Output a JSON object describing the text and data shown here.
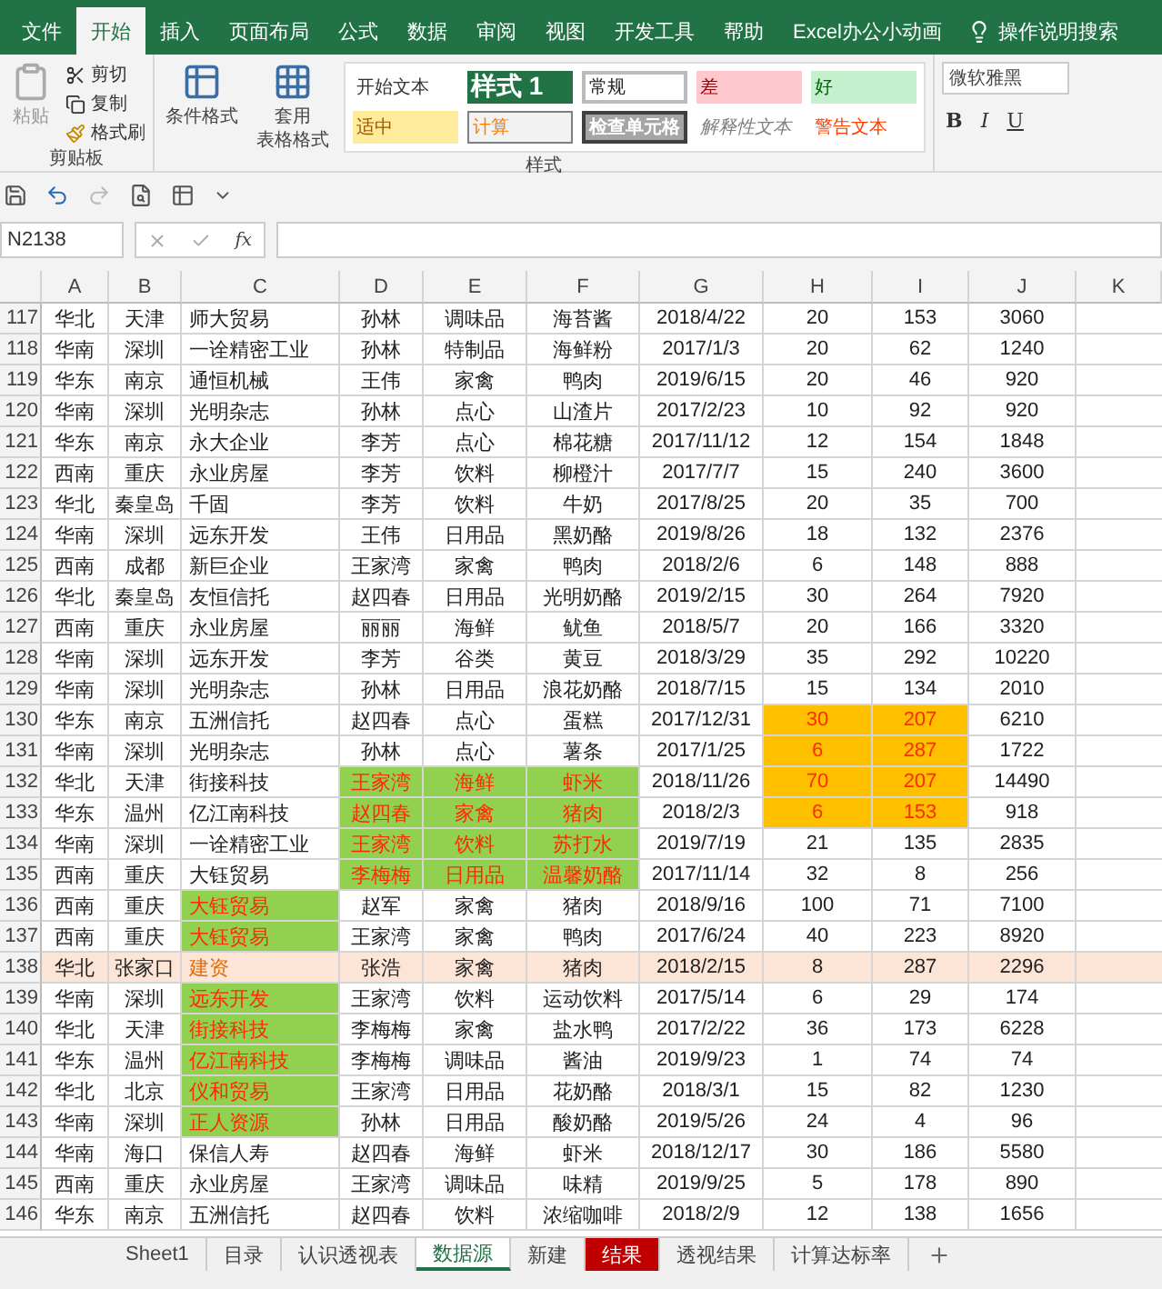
{
  "menu_tabs": [
    {
      "label": "文件",
      "selected": false
    },
    {
      "label": "开始",
      "selected": true
    },
    {
      "label": "插入",
      "selected": false
    },
    {
      "label": "页面布局",
      "selected": false
    },
    {
      "label": "公式",
      "selected": false
    },
    {
      "label": "数据",
      "selected": false
    },
    {
      "label": "审阅",
      "selected": false
    },
    {
      "label": "视图",
      "selected": false
    },
    {
      "label": "开发工具",
      "selected": false
    },
    {
      "label": "帮助",
      "selected": false
    },
    {
      "label": "Excel办公小动画",
      "selected": false
    }
  ],
  "tell_me": "操作说明搜索",
  "clipboard": {
    "paste": "粘贴",
    "cut": "剪切",
    "copy": "复制",
    "format_painter": "格式刷",
    "group_label": "剪贴板"
  },
  "styles": {
    "conditional_format": "条件格式",
    "table_format": [
      "套用",
      "表格格式"
    ],
    "group_label": "样式",
    "gallery": [
      {
        "text": "开始文本",
        "kind": "plain"
      },
      {
        "text": "样式 1",
        "kind": "title"
      },
      {
        "text": "常规",
        "kind": "normal"
      },
      {
        "text": "差",
        "kind": "bad"
      },
      {
        "text": "好",
        "kind": "good"
      },
      {
        "text": "适中",
        "kind": "neutral"
      },
      {
        "text": "计算",
        "kind": "calc"
      },
      {
        "text": "检查单元格",
        "kind": "check"
      },
      {
        "text": "解释性文本",
        "kind": "explain"
      },
      {
        "text": "警告文本",
        "kind": "warning"
      }
    ]
  },
  "font": {
    "name": "微软雅黑",
    "bold": "B",
    "italic": "I",
    "underline": "U"
  },
  "name_box": "N2138",
  "formula_label": "fx",
  "columns": [
    "A",
    "B",
    "C",
    "D",
    "E",
    "F",
    "G",
    "H",
    "I",
    "J",
    "K"
  ],
  "rows": [
    {
      "header": "117",
      "selected": false,
      "cells": [
        "华北",
        "天津",
        "师大贸易",
        "孙林",
        "调味品",
        "海苔酱",
        "2018/4/22",
        "20",
        "153",
        "3060"
      ]
    },
    {
      "header": "118",
      "selected": false,
      "cells": [
        "华南",
        "深圳",
        "一诠精密工业",
        "孙林",
        "特制品",
        "海鲜粉",
        "2017/1/3",
        "20",
        "62",
        "1240"
      ]
    },
    {
      "header": "119",
      "selected": false,
      "cells": [
        "华东",
        "南京",
        "通恒机械",
        "王伟",
        "家禽",
        "鸭肉",
        "2019/6/15",
        "20",
        "46",
        "920"
      ]
    },
    {
      "header": "120",
      "selected": false,
      "cells": [
        "华南",
        "深圳",
        "光明杂志",
        "孙林",
        "点心",
        "山渣片",
        "2017/2/23",
        "10",
        "92",
        "920"
      ]
    },
    {
      "header": "121",
      "selected": false,
      "cells": [
        "华东",
        "南京",
        "永大企业",
        "李芳",
        "点心",
        "棉花糖",
        "2017/11/12",
        "12",
        "154",
        "1848"
      ]
    },
    {
      "header": "122",
      "selected": false,
      "cells": [
        "西南",
        "重庆",
        "永业房屋",
        "李芳",
        "饮料",
        "柳橙汁",
        "2017/7/7",
        "15",
        "240",
        "3600"
      ]
    },
    {
      "header": "123",
      "selected": false,
      "cells": [
        "华北",
        "秦皇岛",
        "千固",
        "李芳",
        "饮料",
        "牛奶",
        "2017/8/25",
        "20",
        "35",
        "700"
      ]
    },
    {
      "header": "124",
      "selected": false,
      "cells": [
        "华南",
        "深圳",
        "远东开发",
        "王伟",
        "日用品",
        "黑奶酪",
        "2019/8/26",
        "18",
        "132",
        "2376"
      ]
    },
    {
      "header": "125",
      "selected": false,
      "cells": [
        "西南",
        "成都",
        "新巨企业",
        "王家湾",
        "家禽",
        "鸭肉",
        "2018/2/6",
        "6",
        "148",
        "888"
      ]
    },
    {
      "header": "126",
      "selected": false,
      "cells": [
        "华北",
        "秦皇岛",
        "友恒信托",
        "赵四春",
        "日用品",
        "光明奶酪",
        "2019/2/15",
        "30",
        "264",
        "7920"
      ]
    },
    {
      "header": "127",
      "selected": false,
      "cells": [
        "西南",
        "重庆",
        "永业房屋",
        "丽丽",
        "海鲜",
        "鱿鱼",
        "2018/5/7",
        "20",
        "166",
        "3320"
      ]
    },
    {
      "header": "128",
      "selected": false,
      "cells": [
        "华南",
        "深圳",
        "远东开发",
        "李芳",
        "谷类",
        "黄豆",
        "2018/3/29",
        "35",
        "292",
        "10220"
      ]
    },
    {
      "header": "129",
      "selected": false,
      "cells": [
        "华南",
        "深圳",
        "光明杂志",
        "孙林",
        "日用品",
        "浪花奶酪",
        "2018/7/15",
        "15",
        "134",
        "2010"
      ]
    },
    {
      "header": "130",
      "selected": false,
      "cells": [
        "华东",
        "南京",
        "五洲信托",
        "赵四春",
        "点心",
        "蛋糕",
        "2017/12/31",
        {
          "text": "30",
          "kind": "warn"
        },
        {
          "text": "207",
          "kind": "warn"
        },
        "6210"
      ]
    },
    {
      "header": "131",
      "selected": false,
      "cells": [
        "华南",
        "深圳",
        "光明杂志",
        "孙林",
        "点心",
        "薯条",
        "2017/1/25",
        {
          "text": "6",
          "kind": "warn"
        },
        {
          "text": "287",
          "kind": "warn"
        },
        "1722"
      ]
    },
    {
      "header": "132",
      "selected": false,
      "cells": [
        "华北",
        "天津",
        "街接科技",
        {
          "text": "王家湾",
          "kind": "good"
        },
        {
          "text": "海鲜",
          "kind": "good"
        },
        {
          "text": "虾米",
          "kind": "good"
        },
        "2018/11/26",
        {
          "text": "70",
          "kind": "warn"
        },
        {
          "text": "207",
          "kind": "warn"
        },
        "14490"
      ]
    },
    {
      "header": "133",
      "selected": false,
      "cells": [
        "华东",
        "温州",
        "亿江南科技",
        {
          "text": "赵四春",
          "kind": "good"
        },
        {
          "text": "家禽",
          "kind": "good"
        },
        {
          "text": "猪肉",
          "kind": "good"
        },
        "2018/2/3",
        {
          "text": "6",
          "kind": "warn"
        },
        {
          "text": "153",
          "kind": "warn"
        },
        "918"
      ]
    },
    {
      "header": "134",
      "selected": false,
      "cells": [
        "华南",
        "深圳",
        "一诠精密工业",
        {
          "text": "王家湾",
          "kind": "good"
        },
        {
          "text": "饮料",
          "kind": "good"
        },
        {
          "text": "苏打水",
          "kind": "good"
        },
        "2019/7/19",
        "21",
        "135",
        "2835"
      ]
    },
    {
      "header": "135",
      "selected": false,
      "cells": [
        "西南",
        "重庆",
        "大钰贸易",
        {
          "text": "李梅梅",
          "kind": "good"
        },
        {
          "text": "日用品",
          "kind": "good"
        },
        {
          "text": "温馨奶酪",
          "kind": "good"
        },
        "2017/11/14",
        "32",
        "8",
        "256"
      ]
    },
    {
      "header": "136",
      "selected": false,
      "cells": [
        "西南",
        "重庆",
        {
          "text": "大钰贸易",
          "kind": "good"
        },
        "赵军",
        "家禽",
        "猪肉",
        "2018/9/16",
        "100",
        "71",
        "7100"
      ]
    },
    {
      "header": "137",
      "selected": false,
      "cells": [
        "西南",
        "重庆",
        {
          "text": "大钰贸易",
          "kind": "good"
        },
        "王家湾",
        "家禽",
        "鸭肉",
        "2017/6/24",
        "40",
        "223",
        "8920"
      ]
    },
    {
      "header": "138",
      "selected": true,
      "cells": [
        "华北",
        "张家口",
        {
          "text": "建资",
          "kind": "note"
        },
        "张浩",
        "家禽",
        "猪肉",
        "2018/2/15",
        "8",
        "287",
        "2296"
      ]
    },
    {
      "header": "139",
      "selected": false,
      "cells": [
        "华南",
        "深圳",
        {
          "text": "远东开发",
          "kind": "good"
        },
        "王家湾",
        "饮料",
        "运动饮料",
        "2017/5/14",
        "6",
        "29",
        "174"
      ]
    },
    {
      "header": "140",
      "selected": false,
      "cells": [
        "华北",
        "天津",
        {
          "text": "街接科技",
          "kind": "good"
        },
        "李梅梅",
        "家禽",
        "盐水鸭",
        "2017/2/22",
        "36",
        "173",
        "6228"
      ]
    },
    {
      "header": "141",
      "selected": false,
      "cells": [
        "华东",
        "温州",
        {
          "text": "亿江南科技",
          "kind": "good"
        },
        "李梅梅",
        "调味品",
        "酱油",
        "2019/9/23",
        "1",
        "74",
        "74"
      ]
    },
    {
      "header": "142",
      "selected": false,
      "cells": [
        "华北",
        "北京",
        {
          "text": "仪和贸易",
          "kind": "good"
        },
        "王家湾",
        "日用品",
        "花奶酪",
        "2018/3/1",
        "15",
        "82",
        "1230"
      ]
    },
    {
      "header": "143",
      "selected": false,
      "cells": [
        "华南",
        "深圳",
        {
          "text": "正人资源",
          "kind": "good"
        },
        "孙林",
        "日用品",
        "酸奶酪",
        "2019/5/26",
        "24",
        "4",
        "96"
      ]
    },
    {
      "header": "144",
      "selected": false,
      "cells": [
        "华南",
        "海口",
        "保信人寿",
        "赵四春",
        "海鲜",
        "虾米",
        "2018/12/17",
        "30",
        "186",
        "5580"
      ]
    },
    {
      "header": "145",
      "selected": false,
      "cells": [
        "西南",
        "重庆",
        "永业房屋",
        "王家湾",
        "调味品",
        "味精",
        "2019/9/25",
        "5",
        "178",
        "890"
      ]
    },
    {
      "header": "146",
      "selected": false,
      "cells": [
        "华东",
        "南京",
        "五洲信托",
        "赵四春",
        "饮料",
        "浓缩咖啡",
        "2018/2/9",
        "12",
        "138",
        "1656"
      ]
    }
  ],
  "sheet_tabs": [
    {
      "label": "Sheet1",
      "selected": false,
      "kind": "normal"
    },
    {
      "label": "目录",
      "selected": false,
      "kind": "normal"
    },
    {
      "label": "认识透视表",
      "selected": false,
      "kind": "normal"
    },
    {
      "label": "数据源",
      "selected": true,
      "kind": "normal"
    },
    {
      "label": "新建",
      "selected": false,
      "kind": "normal"
    },
    {
      "label": "结果",
      "selected": false,
      "kind": "flagged"
    },
    {
      "label": "透视结果",
      "selected": false,
      "kind": "normal"
    },
    {
      "label": "计算达标率",
      "selected": false,
      "kind": "normal"
    }
  ]
}
